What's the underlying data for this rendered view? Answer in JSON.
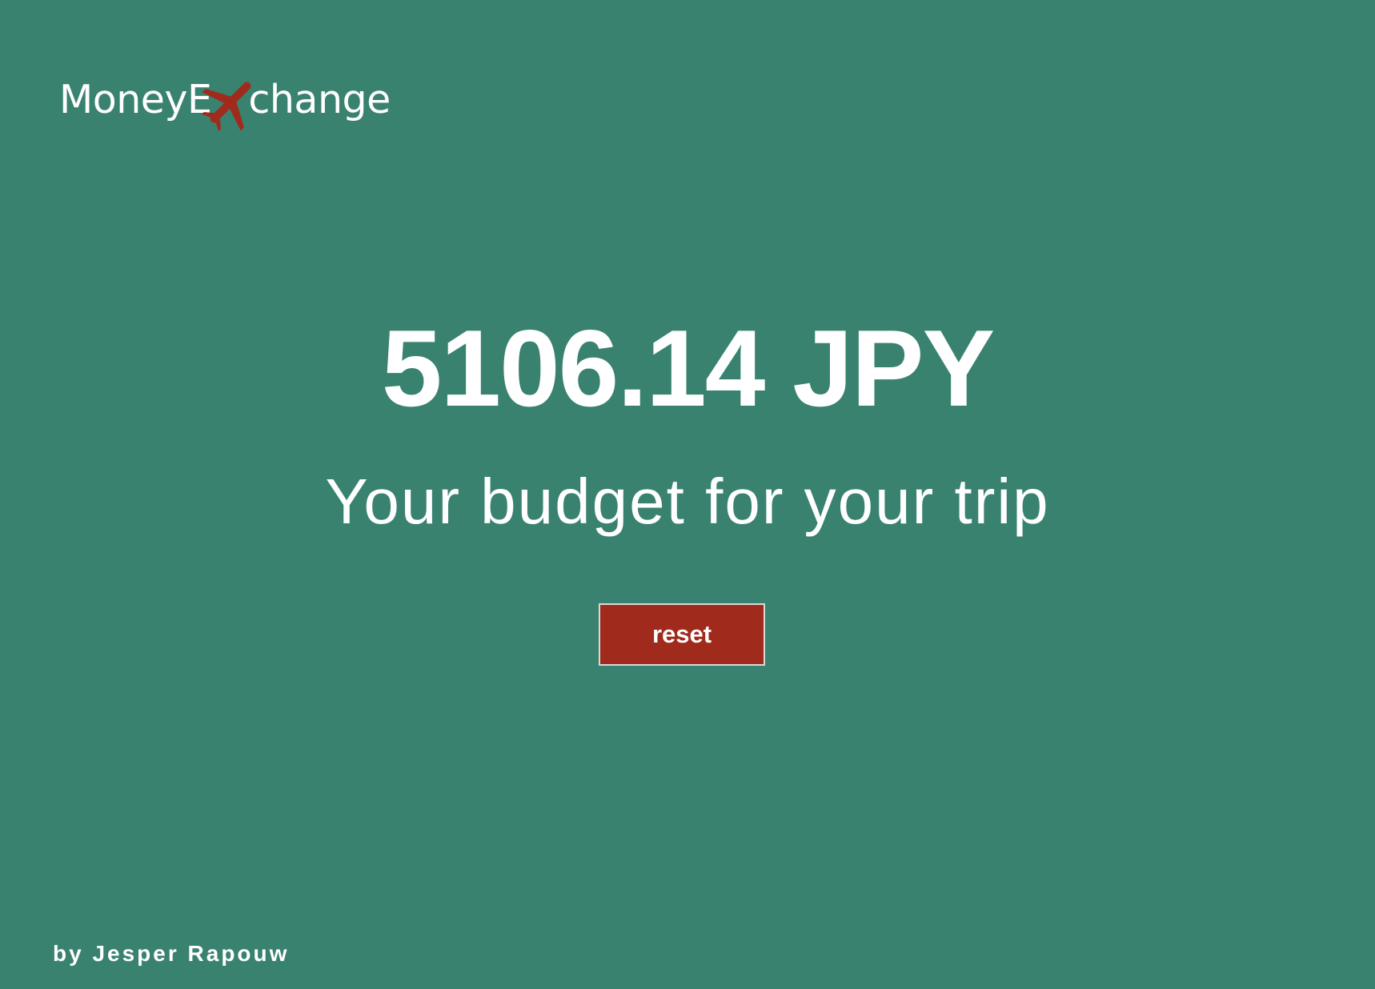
{
  "logo": {
    "prefix": "MoneyE",
    "suffix": "change",
    "icon": "airplane-icon",
    "icon_color": "#a02b1c"
  },
  "result": {
    "amount": "5106.14 JPY",
    "caption": "Your budget for your trip"
  },
  "actions": {
    "reset_label": "reset"
  },
  "footer": {
    "credit": "by Jesper Rapouw"
  },
  "colors": {
    "background": "#3a8270",
    "accent": "#a02b1c",
    "text": "#ffffff"
  }
}
